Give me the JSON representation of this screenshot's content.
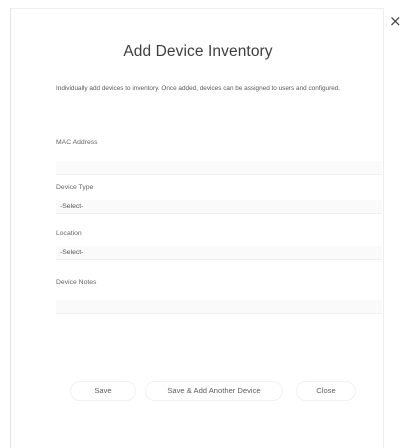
{
  "dialog": {
    "title": "Add Device Inventory",
    "description": "Individually add devices to inventory. Once added, devices can be assigned to users and configured.",
    "close_glyph": "×"
  },
  "form": {
    "mac_address": {
      "label": "MAC Address",
      "value": ""
    },
    "device_type": {
      "label": "Device Type",
      "selected": "-Select-"
    },
    "location": {
      "label": "Location",
      "selected": "-Select-"
    },
    "device_notes": {
      "label": "Device Notes",
      "value": ""
    }
  },
  "buttons": {
    "save": "Save",
    "save_add_another": "Save & Add Another Device",
    "close": "Close"
  }
}
